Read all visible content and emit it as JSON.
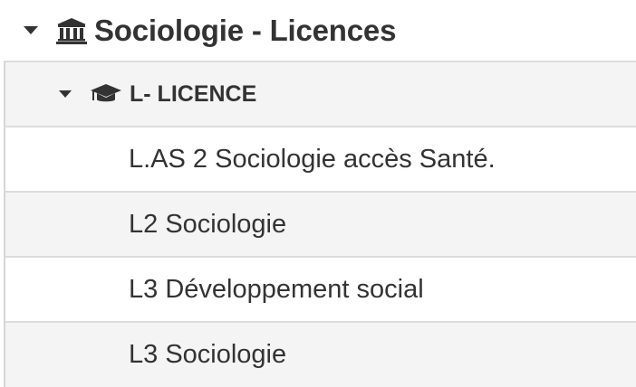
{
  "tree": {
    "root": {
      "label": "Sociologie - Licences",
      "icon": "institution-icon",
      "expanded": true
    },
    "group": {
      "label": "L- LICENCE",
      "icon": "graduation-cap-icon",
      "expanded": true
    },
    "items": [
      {
        "label": "L.AS 2 Sociologie accès Santé."
      },
      {
        "label": "L2 Sociologie"
      },
      {
        "label": "L3 Développement social"
      },
      {
        "label": "L3 Sociologie"
      }
    ]
  }
}
